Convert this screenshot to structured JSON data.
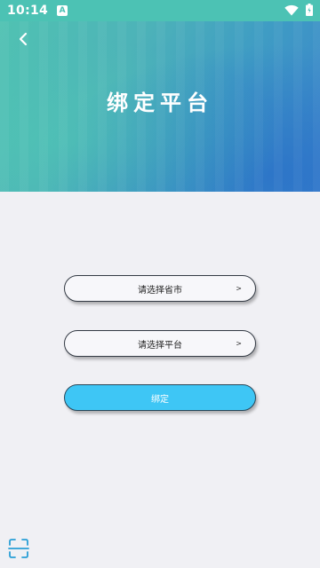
{
  "status_bar": {
    "time": "10:14",
    "notification_letter": "A",
    "icons": [
      "wifi-icon",
      "battery-icon"
    ]
  },
  "header": {
    "back_icon": "back-chevron-icon",
    "title": "绑定平台"
  },
  "form": {
    "province_select": {
      "label": "请选择省市",
      "chevron": ">"
    },
    "platform_select": {
      "label": "请选择平台",
      "chevron": ">"
    },
    "bind_button": {
      "label": "绑定"
    }
  },
  "footer": {
    "scan_icon": "scan-icon"
  },
  "colors": {
    "header_start": "#50c2b2",
    "header_end": "#3a82cc",
    "background": "#f0f0f4",
    "bind_button": "#3ec6f5",
    "scan_icon": "#2a9fd6"
  }
}
